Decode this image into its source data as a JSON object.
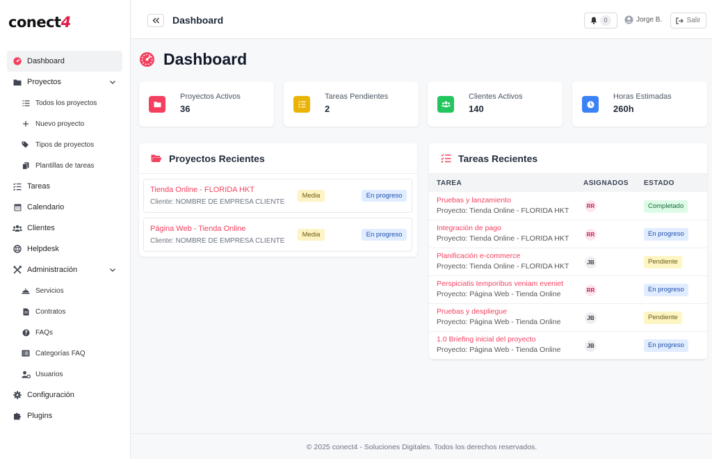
{
  "logo": {
    "text": "conect",
    "accent": "4"
  },
  "sidebar": {
    "items": [
      {
        "label": "Dashboard",
        "icon": "gauge-icon",
        "active": true
      },
      {
        "label": "Proyectos",
        "icon": "folder-icon",
        "expandable": true
      },
      {
        "label": "Todos los proyectos",
        "icon": "list-icon",
        "sub": true
      },
      {
        "label": "Nuevo proyecto",
        "icon": "plus-icon",
        "sub": true
      },
      {
        "label": "Tipos de proyectos",
        "icon": "tags-icon",
        "sub": true
      },
      {
        "label": "Plantillas de tareas",
        "icon": "copy-icon",
        "sub": true
      },
      {
        "label": "Tareas",
        "icon": "tasks-icon"
      },
      {
        "label": "Calendario",
        "icon": "calendar-icon"
      },
      {
        "label": "Clientes",
        "icon": "users-icon"
      },
      {
        "label": "Helpdesk",
        "icon": "lifebuoy-icon"
      },
      {
        "label": "Administración",
        "icon": "tools-icon",
        "expandable": true
      },
      {
        "label": "Servicios",
        "icon": "service-icon",
        "sub": true
      },
      {
        "label": "Contratos",
        "icon": "file-icon",
        "sub": true
      },
      {
        "label": "FAQs",
        "icon": "question-icon",
        "sub": true
      },
      {
        "label": "Categorías FAQ",
        "icon": "category-icon",
        "sub": true
      },
      {
        "label": "Usuarios",
        "icon": "user-cog-icon",
        "sub": true
      },
      {
        "label": "Configuración",
        "icon": "cog-icon"
      },
      {
        "label": "Plugins",
        "icon": "puzzle-icon"
      }
    ]
  },
  "header": {
    "title": "Dashboard",
    "notifications_count": "0",
    "user_name": "Jorge B.",
    "logout_label": "Salir"
  },
  "page": {
    "title": "Dashboard"
  },
  "stats": [
    {
      "label": "Proyectos Activos",
      "value": "36",
      "color": "#f43f5e",
      "icon": "folder-icon"
    },
    {
      "label": "Tareas Pendientes",
      "value": "2",
      "color": "#eab308",
      "icon": "tasks-icon"
    },
    {
      "label": "Clientes Activos",
      "value": "140",
      "color": "#22c55e",
      "icon": "users-icon"
    },
    {
      "label": "Horas Estimadas",
      "value": "260h",
      "color": "#3b82f6",
      "icon": "clock-icon"
    }
  ],
  "recent_projects": {
    "title": "Proyectos Recientes",
    "items": [
      {
        "name": "Tienda Online - FLORIDA HKT",
        "client": "Cliente: NOMBRE DE EMPRESA CLIENTE",
        "priority": "Media",
        "status": "En progreso"
      },
      {
        "name": "Página Web - Tienda Online",
        "client": "Cliente: NOMBRE DE EMPRESA CLIENTE",
        "priority": "Media",
        "status": "En progreso"
      }
    ]
  },
  "recent_tasks": {
    "title": "Tareas Recientes",
    "columns": [
      "TAREA",
      "ASIGNADOS",
      "ESTADO"
    ],
    "rows": [
      {
        "name": "Pruebas y lanzamiento",
        "project": "Proyecto: Tienda Online - FLORIDA HKT",
        "assignee": "RR",
        "status": "Completado",
        "status_type": "done"
      },
      {
        "name": "Integración de pago",
        "project": "Proyecto: Tienda Online - FLORIDA HKT",
        "assignee": "RR",
        "status": "En progreso",
        "status_type": "progress"
      },
      {
        "name": "Planificación e-commerce",
        "project": "Proyecto: Tienda Online - FLORIDA HKT",
        "assignee": "JB",
        "status": "Pendiente",
        "status_type": "pending"
      },
      {
        "name": "Perspiciatis temporibus veniam eveniet",
        "project": "Proyecto: Página Web - Tienda Online",
        "assignee": "RR",
        "status": "En progreso",
        "status_type": "progress"
      },
      {
        "name": "Pruebas y despliegue",
        "project": "Proyecto: Página Web - Tienda Online",
        "assignee": "JB",
        "status": "Pendiente",
        "status_type": "pending"
      },
      {
        "name": "1.0 Briefing inicial del proyecto",
        "project": "Proyecto: Página Web - Tienda Online",
        "assignee": "JB",
        "status": "En progreso",
        "status_type": "progress"
      }
    ]
  },
  "footer": {
    "text": "© 2025 conect4 - Soluciones Digitales. Todos los derechos reservados."
  }
}
